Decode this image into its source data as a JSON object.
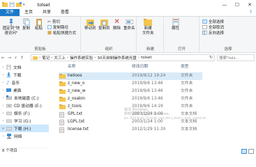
{
  "window": {
    "title": "tolset",
    "controls": {
      "minimize": "—",
      "maximize": "☐",
      "close": "✕"
    }
  },
  "ribbon_tabs": {
    "file": "文件",
    "home": "主页",
    "share": "共享",
    "view": "查看",
    "help": "?"
  },
  "ribbon": {
    "clipboard": {
      "label": "剪贴板",
      "pin_quick": "固定到\"快速访问\"",
      "copy": "复制",
      "paste": "粘贴",
      "cut": "剪切",
      "copy_path": "复制路径",
      "paste_shortcut": "粘贴快捷方式"
    },
    "organize": {
      "label": "组织",
      "move_to": "移动到",
      "copy_to": "复制到",
      "delete": "删除",
      "rename": "重命名"
    },
    "new": {
      "label": "新建",
      "new_folder": "新建\n文件夹"
    },
    "open": {
      "label": "打开",
      "properties": "属性"
    },
    "select": {
      "label": "选择",
      "select_all": "全部选择",
      "select_none": "全部取消",
      "invert": "反向选择"
    }
  },
  "address": {
    "back": "←",
    "forward": "→",
    "up_list": "∨",
    "up": "↑",
    "crumbs": [
      "笔记",
      "大三上",
      "操作系统实验",
      "30天自制操作系统光盘",
      "tolset"
    ],
    "separator": "›",
    "refresh": "↻",
    "search_placeholder": "搜索\"tols..."
  },
  "sidebar": {
    "items": [
      {
        "label": "文档",
        "icon": "documents-icon"
      },
      {
        "label": "下载",
        "icon": "downloads-icon"
      },
      {
        "label": "音乐",
        "icon": "music-icon"
      },
      {
        "label": "桌面",
        "icon": "desktop-icon"
      },
      {
        "label": "本地磁盘 (C:)",
        "icon": "drive-c-icon"
      },
      {
        "label": "CD 驱动器 (E:)",
        "icon": "cd-drive-icon"
      },
      {
        "label": "娱乐 (F:)",
        "icon": "drive-icon"
      },
      {
        "label": "学习 (G:)",
        "icon": "drive-icon"
      },
      {
        "label": "下载 (H:)",
        "icon": "drive-icon"
      },
      {
        "label": "网络",
        "icon": "network-icon"
      }
    ]
  },
  "columns": {
    "name": "名称",
    "date": "修改日期",
    "type": "类型"
  },
  "files": [
    {
      "name": "helloos",
      "date": "2019/9/12 19:24",
      "type": "文件夹",
      "kind": "folder"
    },
    {
      "name": "z_new_o",
      "date": "2019/9/6 13:46",
      "type": "文件夹",
      "kind": "folder"
    },
    {
      "name": "z_new_w",
      "date": "2019/9/6 13:46",
      "type": "文件夹",
      "kind": "folder"
    },
    {
      "name": "z_osabin",
      "date": "2019/9/6 13:46",
      "type": "文件夹",
      "kind": "folder"
    },
    {
      "name": "z_tools",
      "date": "2019/9/6 14:19",
      "type": "文件夹",
      "kind": "folder"
    },
    {
      "name": "GPL.txt",
      "date": "2003/1/24 1:00",
      "type": "文本文档",
      "kind": "txt"
    },
    {
      "name": "LGPL.txt",
      "date": "2003/1/24 1:00",
      "type": "文本文档",
      "kind": "txt"
    },
    {
      "name": "license.txt",
      "date": "2012/1/29 11:30",
      "type": "文本文档",
      "kind": "txt"
    }
  ],
  "watermark": {
    "line1": "激活 Windows",
    "line2": "转到\"设置\"以激活 Windows。",
    "line3": "Jan 2019 build 13 mkdir cwd_dsk z_tools z_tools_nskmil.tai"
  },
  "status": {
    "text": "8 个项目"
  },
  "colors": {
    "accent": "#1979ca",
    "selected": "#cce8ff",
    "folder": "#f4c54f",
    "highlight_row": "#d9ebf9"
  }
}
